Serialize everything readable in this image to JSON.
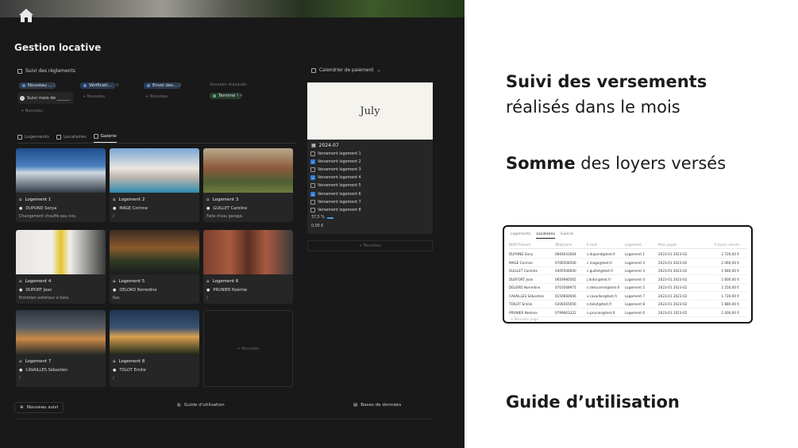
{
  "page": {
    "title": "Gestion locative"
  },
  "payments": {
    "section_label": "Suivi des règlements",
    "columns": [
      {
        "label": "Nouveau ...",
        "count": "1"
      },
      {
        "label": "Vérificati...",
        "count": "0"
      },
      {
        "label": "Envoi des...",
        "count": "0"
      }
    ],
    "hidden_groups": "Groupes masqués",
    "done": {
      "label": "Terminé !",
      "count": "4"
    },
    "card_label": "Suivi mois de ______",
    "add_label": "Nouveau"
  },
  "tabs": [
    {
      "label": "Logements"
    },
    {
      "label": "Locataires"
    },
    {
      "label": "Galerie"
    }
  ],
  "gallery": [
    {
      "name": "Logement 1",
      "tenant": "DUPOND Sonya",
      "note": "Changement chauffe eau nov."
    },
    {
      "name": "Logement 2",
      "tenant": "MAGE Corinne",
      "note": "/"
    },
    {
      "name": "Logement 3",
      "tenant": "GUILLET Caroline",
      "note": "Faite d'eau garage."
    },
    {
      "name": "Logement 4",
      "tenant": "DUPORT Jean",
      "note": "Entretien extérieur à faire."
    },
    {
      "name": "Logement 5",
      "tenant": "DELORD Norredine",
      "note": "Ras"
    },
    {
      "name": "Logement 6",
      "tenant": "PRUNIER Noémie",
      "note": "/"
    },
    {
      "name": "Logement 7",
      "tenant": "CAVAILLES Sébastien",
      "note": "/"
    },
    {
      "name": "Logement 8",
      "tenant": "TOLOT Emilie",
      "note": "/"
    }
  ],
  "gallery_new": "Nouveau",
  "calendar": {
    "label": "Calendrier de paiement",
    "cover_month": "July",
    "month": "2024-07",
    "items": [
      {
        "label": "Versement logement 1",
        "checked": false
      },
      {
        "label": "Versement logement 2",
        "checked": true
      },
      {
        "label": "Versement logement 3",
        "checked": false
      },
      {
        "label": "Versement logement 4",
        "checked": true
      },
      {
        "label": "Versement logement 5",
        "checked": false
      },
      {
        "label": "Versement logement 6",
        "checked": true
      },
      {
        "label": "Versement logement 7",
        "checked": false
      },
      {
        "label": "Versement logement 8",
        "checked": false
      }
    ],
    "percent": "37,5 %",
    "total": "0,00 €",
    "new_label": "Nouveau"
  },
  "footer": {
    "new_followup": "Nouveau suivi",
    "guide": "Guide d'utilisation",
    "databases": "Bases de données"
  },
  "right": {
    "heading1": "Suivi des versements",
    "heading1_sub": "réalisés dans le mois",
    "heading2_bold": "Somme",
    "heading2_rest": " des loyers versés",
    "heading3": "Guide d’utilisation"
  },
  "tenant_table": {
    "tabs": [
      "Logements",
      "Locataires",
      "Galerie"
    ],
    "headers": [
      "NOM Prénom",
      "Téléphone",
      "E-mail",
      "Logement",
      "Mois payés",
      "Σ loyers versés"
    ],
    "rows": [
      [
        "DUPOND Sony",
        "0664641664",
        "s.dupond@test.fr",
        "Logement 1",
        "2023-01  2023-02",
        "2 720,00 €"
      ],
      [
        "MAGE Corinne",
        "0706508506",
        "c.mage@test.fr",
        "Logement 2",
        "2023-01  2023-02",
        "2 060,00 €"
      ],
      [
        "GUILLET Caroline",
        "0405506600",
        "c.guillet@test.fr",
        "Logement 3",
        "2023-01  2023-02",
        "1 680,00 €"
      ],
      [
        "DURFORT Jean",
        "0659980565",
        "j.dufor@test.fr",
        "Logement 4",
        "2023-01  2023-02",
        "2 800,00 €"
      ],
      [
        "DELORD Norredine",
        "0703568975",
        "n.delourmel@test.fr",
        "Logement 5",
        "2023-01  2023-02",
        "2 250,00 €"
      ],
      [
        "CAVAILLES Sébastien",
        "0150660606",
        "s.cavailles@test.fr",
        "Logement 7",
        "2023-01  2023-02",
        "1 720,00 €"
      ],
      [
        "TOILOT Emilie",
        "0206565656",
        "e.toilot@test.fr",
        "Logement 8",
        "2023-01  2023-02",
        "1 880,00 €"
      ],
      [
        "PRUNIER Noémie",
        "0799663322",
        "n.prunier@test.fr",
        "Logement 6",
        "2023-01  2023-02",
        "2 400,00 €"
      ]
    ],
    "footer": "Nouvelle page"
  }
}
